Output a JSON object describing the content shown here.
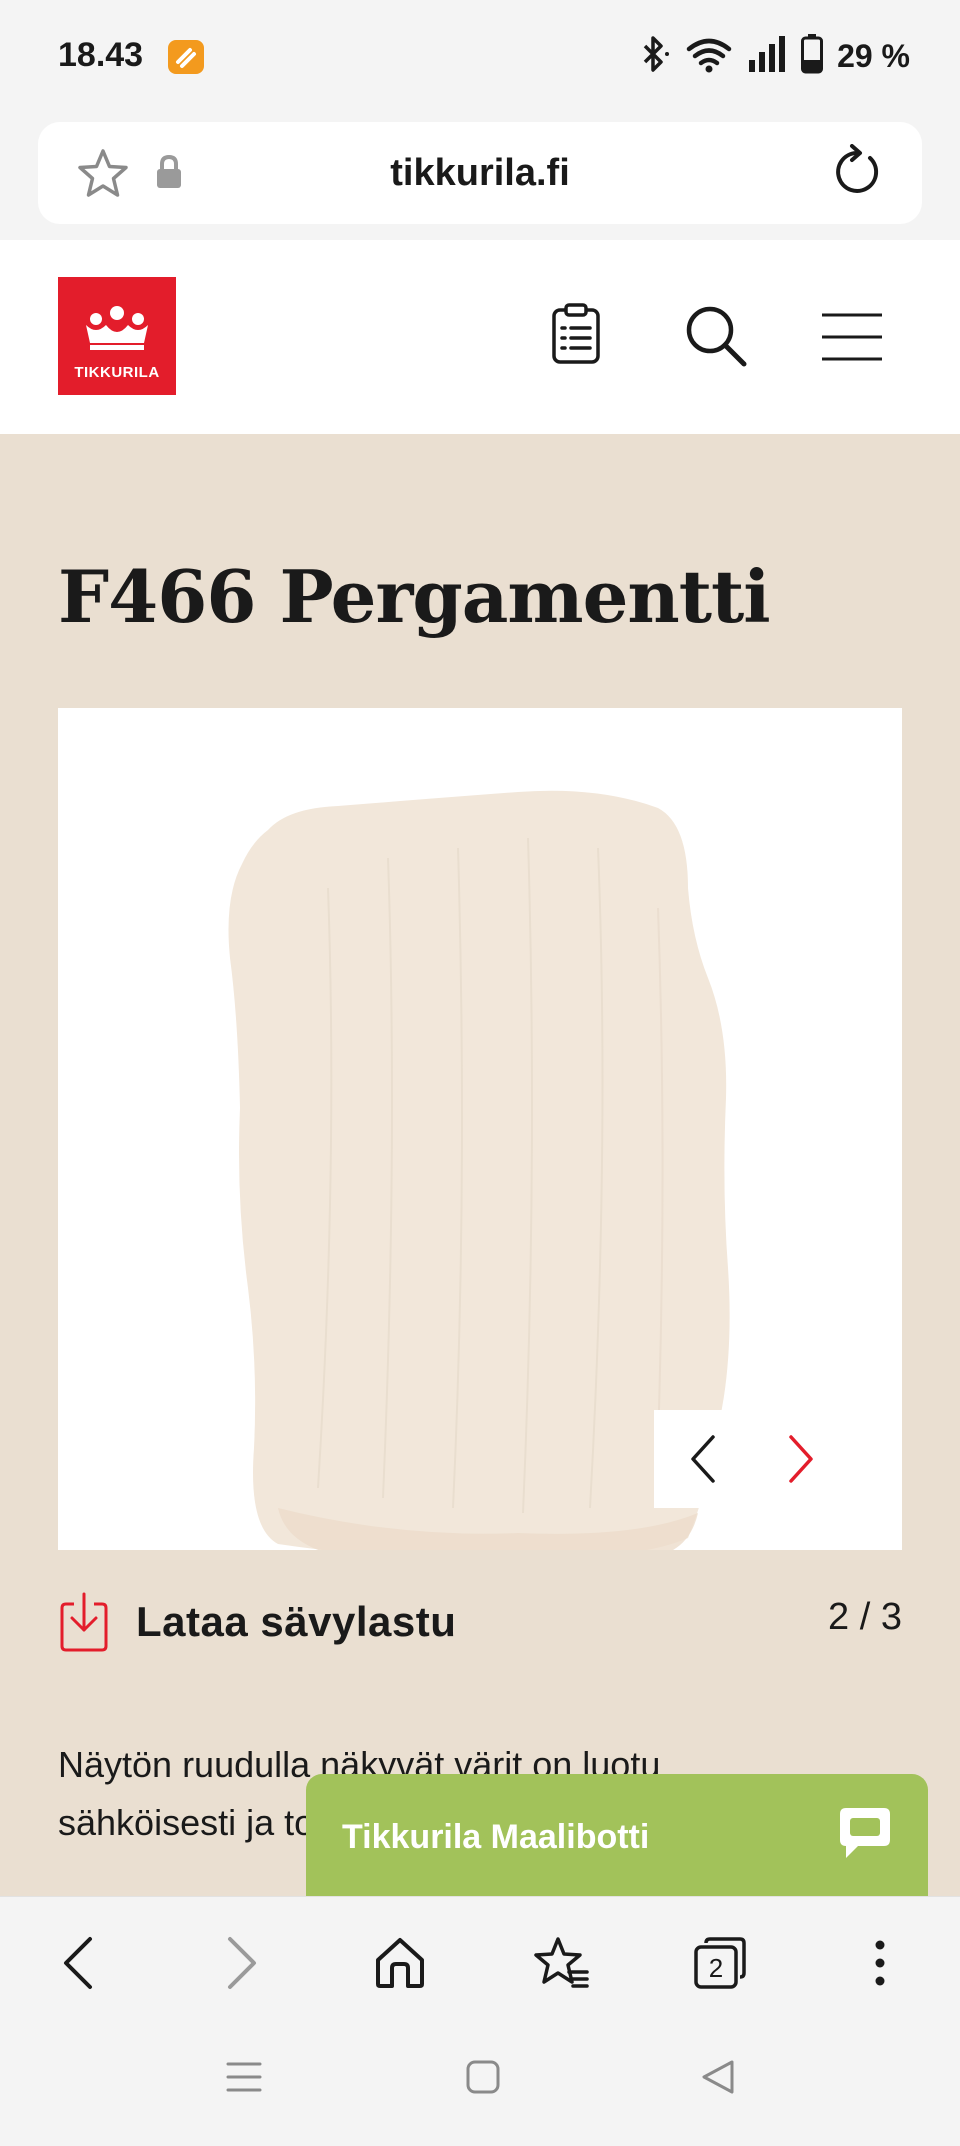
{
  "status_bar": {
    "time": "18.43",
    "battery": "29 %",
    "icons": [
      "app-notification-icon",
      "bluetooth-icon",
      "wifi-icon",
      "signal-icon",
      "battery-icon"
    ]
  },
  "browser": {
    "url": "tikkurila.fi",
    "tab_count": "2"
  },
  "site": {
    "logo_text": "TIKKURILA",
    "brand_color": "#e31d2b"
  },
  "product": {
    "title": "F466 Pergamentti",
    "swatch_color": "#f2e7da",
    "background_color": "#eadfd1",
    "download_label": "Lataa sävylastu",
    "image_counter": "2 / 3",
    "description": "Näytön ruudulla näkyvät värit on luotu sähköisesti ja todellisista vär"
  },
  "chat": {
    "label": "Tikkurila Maalibotti",
    "color": "#a2c25a"
  }
}
